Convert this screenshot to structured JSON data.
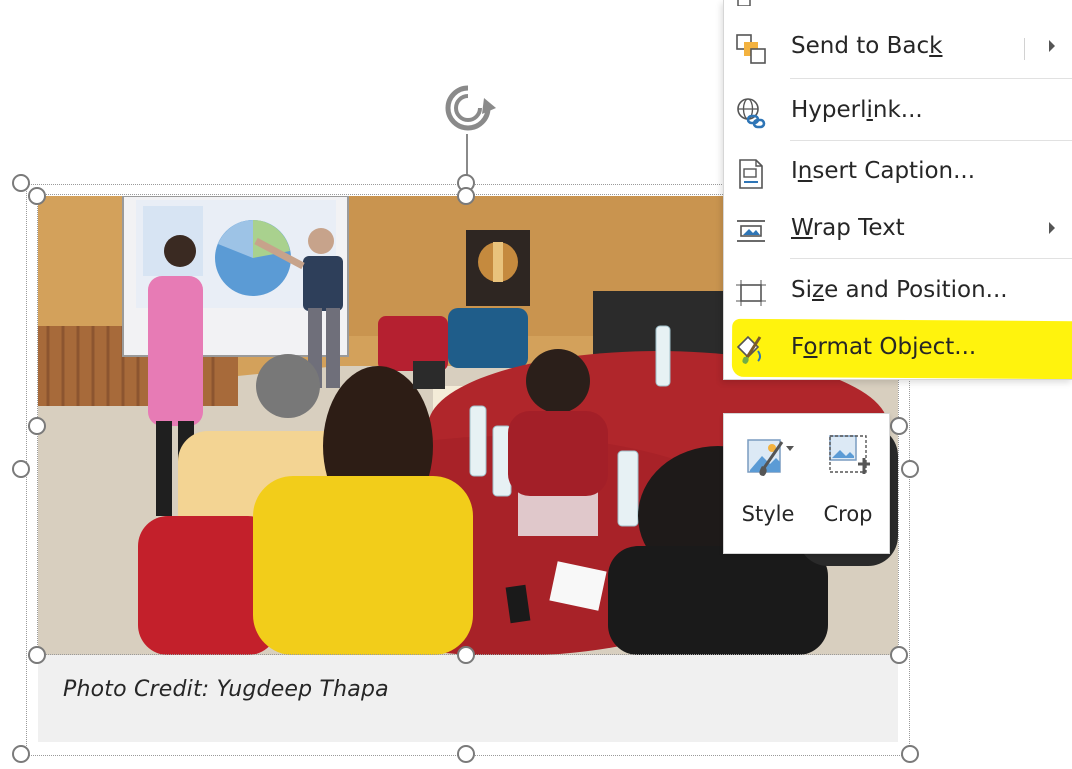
{
  "menu": {
    "items": [
      {
        "id": "send-to-back",
        "label_pre": "Send to Bac",
        "label_ul": "k",
        "label_post": "",
        "icon": "send-to-back-icon",
        "has_submenu": true
      },
      {
        "id": "hyperlink",
        "label_pre": "Hyperl",
        "label_ul": "i",
        "label_post": "nk...",
        "icon": "hyperlink-icon",
        "has_submenu": false
      },
      {
        "id": "insert-caption",
        "label_pre": "I",
        "label_ul": "n",
        "label_post": "sert Caption...",
        "icon": "insert-caption-icon",
        "has_submenu": false
      },
      {
        "id": "wrap-text",
        "label_pre": "",
        "label_ul": "W",
        "label_post": "rap Text",
        "icon": "wrap-text-icon",
        "has_submenu": true
      },
      {
        "id": "size-and-position",
        "label_pre": "Si",
        "label_ul": "z",
        "label_post": "e and Position...",
        "icon": "size-position-icon",
        "has_submenu": false
      },
      {
        "id": "format-object",
        "label_pre": "F",
        "label_ul": "o",
        "label_post": "rmat Object...",
        "icon": "format-object-icon",
        "has_submenu": false,
        "highlighted": true
      }
    ]
  },
  "toolbar": {
    "style_label": "Style",
    "crop_label": "Crop"
  },
  "caption": {
    "text": "Photo Credit: Yugdeep Thapa"
  },
  "colors": {
    "highlight": "#fff200",
    "handle_border": "#7a7a7a",
    "caption_bg": "#f0f0f0"
  }
}
